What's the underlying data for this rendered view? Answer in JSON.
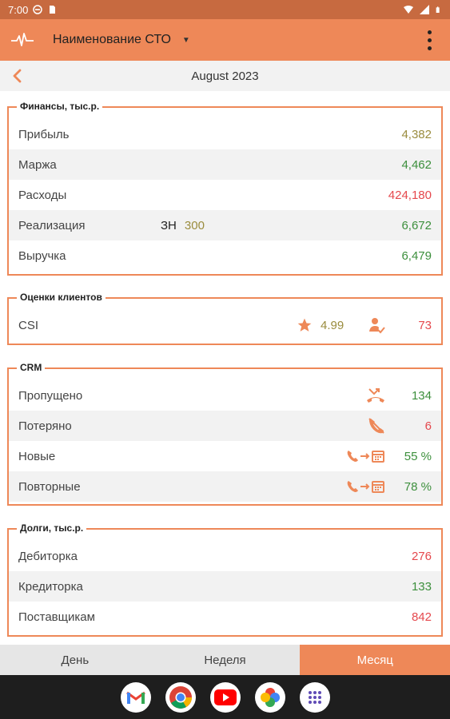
{
  "status_bar": {
    "time": "7:00"
  },
  "app_bar": {
    "title": "Наименование СТО"
  },
  "period": {
    "label": "August 2023"
  },
  "finance": {
    "title": "Финансы, тыс.р.",
    "rows": [
      {
        "label": "Прибыль",
        "value": "4,382"
      },
      {
        "label": "Маржа",
        "value": "4,462"
      },
      {
        "label": "Расходы",
        "value": "424,180"
      },
      {
        "label": "Реализация",
        "zn_label": "ЗН",
        "zn_value": "300",
        "value": "6,672"
      },
      {
        "label": "Выручка",
        "value": "6,479"
      }
    ]
  },
  "ratings": {
    "title": "Оценки клиентов",
    "csi_label": "CSI",
    "csi_score": "4.99",
    "csi_count": "73"
  },
  "crm": {
    "title": "CRM",
    "rows": [
      {
        "label": "Пропущено",
        "value": "134",
        "icon": "missed-call-icon"
      },
      {
        "label": "Потеряно",
        "value": "6",
        "icon": "lost-call-icon"
      },
      {
        "label": "Новые",
        "value": "55 %",
        "icon": "call-to-calendar-icon"
      },
      {
        "label": "Повторные",
        "value": "78 %",
        "icon": "call-to-calendar-icon"
      }
    ]
  },
  "debts": {
    "title": "Долги, тыс.р.",
    "rows": [
      {
        "label": "Дебиторка",
        "value": "276"
      },
      {
        "label": "Кредиторка",
        "value": "133"
      },
      {
        "label": "Поставщикам",
        "value": "842"
      }
    ]
  },
  "tabs": [
    {
      "label": "День"
    },
    {
      "label": "Неделя"
    },
    {
      "label": "Месяц"
    }
  ],
  "dock": [
    "gmail-icon",
    "chrome-icon",
    "youtube-icon",
    "photos-icon",
    "app-drawer-icon"
  ],
  "colors": {
    "accent": "#ee8858",
    "green": "#3c8f3c",
    "red": "#e5484d",
    "olive": "#9a8c3e"
  }
}
